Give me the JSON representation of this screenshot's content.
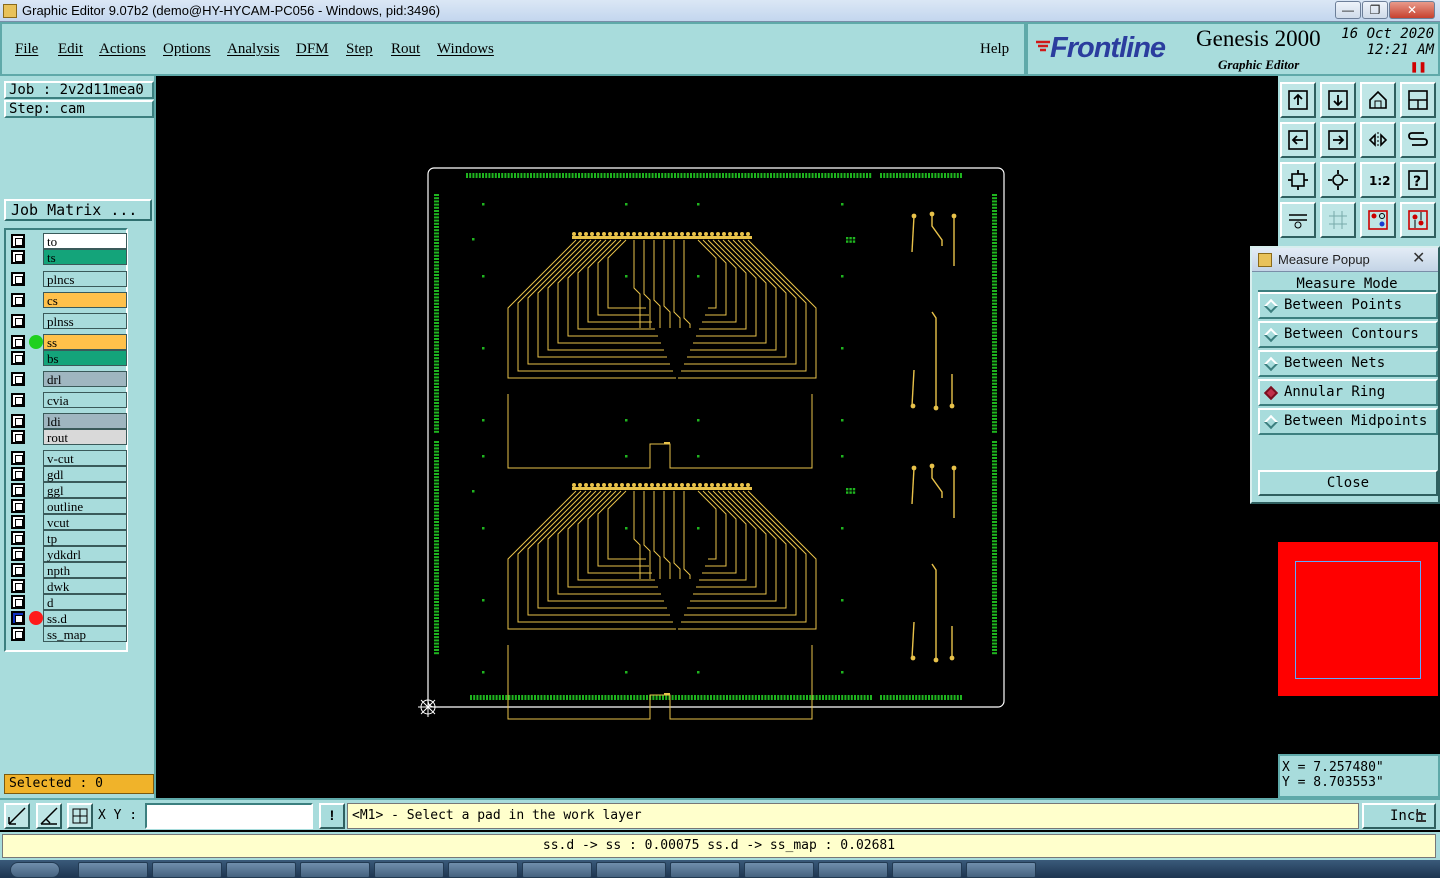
{
  "window": {
    "title": "Graphic Editor 9.07b2 (demo@HY-HYCAM-PC056 - Windows, pid:3496)",
    "minimize": "—",
    "maximize": "❐",
    "close": "✕"
  },
  "menu": {
    "items": [
      "File",
      "Edit",
      "Actions",
      "Options",
      "Analysis",
      "DFM",
      "Step",
      "Rout",
      "Windows"
    ],
    "help": "Help"
  },
  "brand": {
    "logo": "Frontline",
    "product": "Genesis 2000",
    "subtitle": "Graphic Editor",
    "date": "16 Oct 2020",
    "time": "12:21 AM"
  },
  "left": {
    "job": "Job : 2v2d11mea0",
    "step": "Step: cam",
    "job_matrix": "Job Matrix ...",
    "selected": "Selected : 0",
    "layers": [
      {
        "name": "to",
        "color": "#ffffff",
        "dot": ""
      },
      {
        "name": "ts",
        "color": "#14a47a",
        "dot": ""
      },
      {
        "name": "plncs",
        "color": "#a8dcdc",
        "dot": ""
      },
      {
        "name": "cs",
        "color": "#ffc14a",
        "dot": ""
      },
      {
        "name": "plnss",
        "color": "#a8dcdc",
        "dot": ""
      },
      {
        "name": "ss",
        "color": "#ffc14a",
        "dot": "#1fd01f"
      },
      {
        "name": "bs",
        "color": "#14a47a",
        "dot": ""
      },
      {
        "name": "drl",
        "color": "#9fb6c0",
        "dot": ""
      },
      {
        "name": "cvia",
        "color": "#a8dcdc",
        "dot": ""
      },
      {
        "name": "ldi",
        "color": "#9fb6c0",
        "dot": ""
      },
      {
        "name": "rout",
        "color": "#d9d9d9",
        "dot": ""
      },
      {
        "name": "v-cut",
        "color": "#a8dcdc",
        "dot": ""
      },
      {
        "name": "gdl",
        "color": "#a8dcdc",
        "dot": ""
      },
      {
        "name": "ggl",
        "color": "#a8dcdc",
        "dot": ""
      },
      {
        "name": "outline",
        "color": "#a8dcdc",
        "dot": ""
      },
      {
        "name": "vcut",
        "color": "#a8dcdc",
        "dot": ""
      },
      {
        "name": "tp",
        "color": "#a8dcdc",
        "dot": ""
      },
      {
        "name": "ydkdrl",
        "color": "#a8dcdc",
        "dot": ""
      },
      {
        "name": "npth",
        "color": "#a8dcdc",
        "dot": ""
      },
      {
        "name": "dwk",
        "color": "#a8dcdc",
        "dot": ""
      },
      {
        "name": "d",
        "color": "#a8dcdc",
        "dot": ""
      },
      {
        "name": "ss.d",
        "color": "#a8dcdc",
        "dot": "#ff1a1a"
      },
      {
        "name": "ss_map",
        "color": "#a8dcdc",
        "dot": ""
      }
    ]
  },
  "popup": {
    "title": "Measure Popup",
    "mode_title": "Measure Mode",
    "options": [
      "Between Points",
      "Between Contours",
      "Between Nets",
      "Annular Ring",
      "Between Midpoints"
    ],
    "active": "Annular Ring",
    "close": "Close"
  },
  "coords": {
    "x": "X = 7.257480\"",
    "y": "Y = 8.703553\""
  },
  "bottom": {
    "xy_label": "X Y :",
    "xy_value": "",
    "excl": "!",
    "prompt": "<M1> - Select a pad in the work layer",
    "units": "Inch"
  },
  "status": {
    "text": "ss.d -> ss : 0.00075   ss.d -> ss_map : 0.02681"
  },
  "colors": {
    "panel": "#a8dcdc",
    "trace": "#e8c24a",
    "pad": "#1fb51f"
  }
}
